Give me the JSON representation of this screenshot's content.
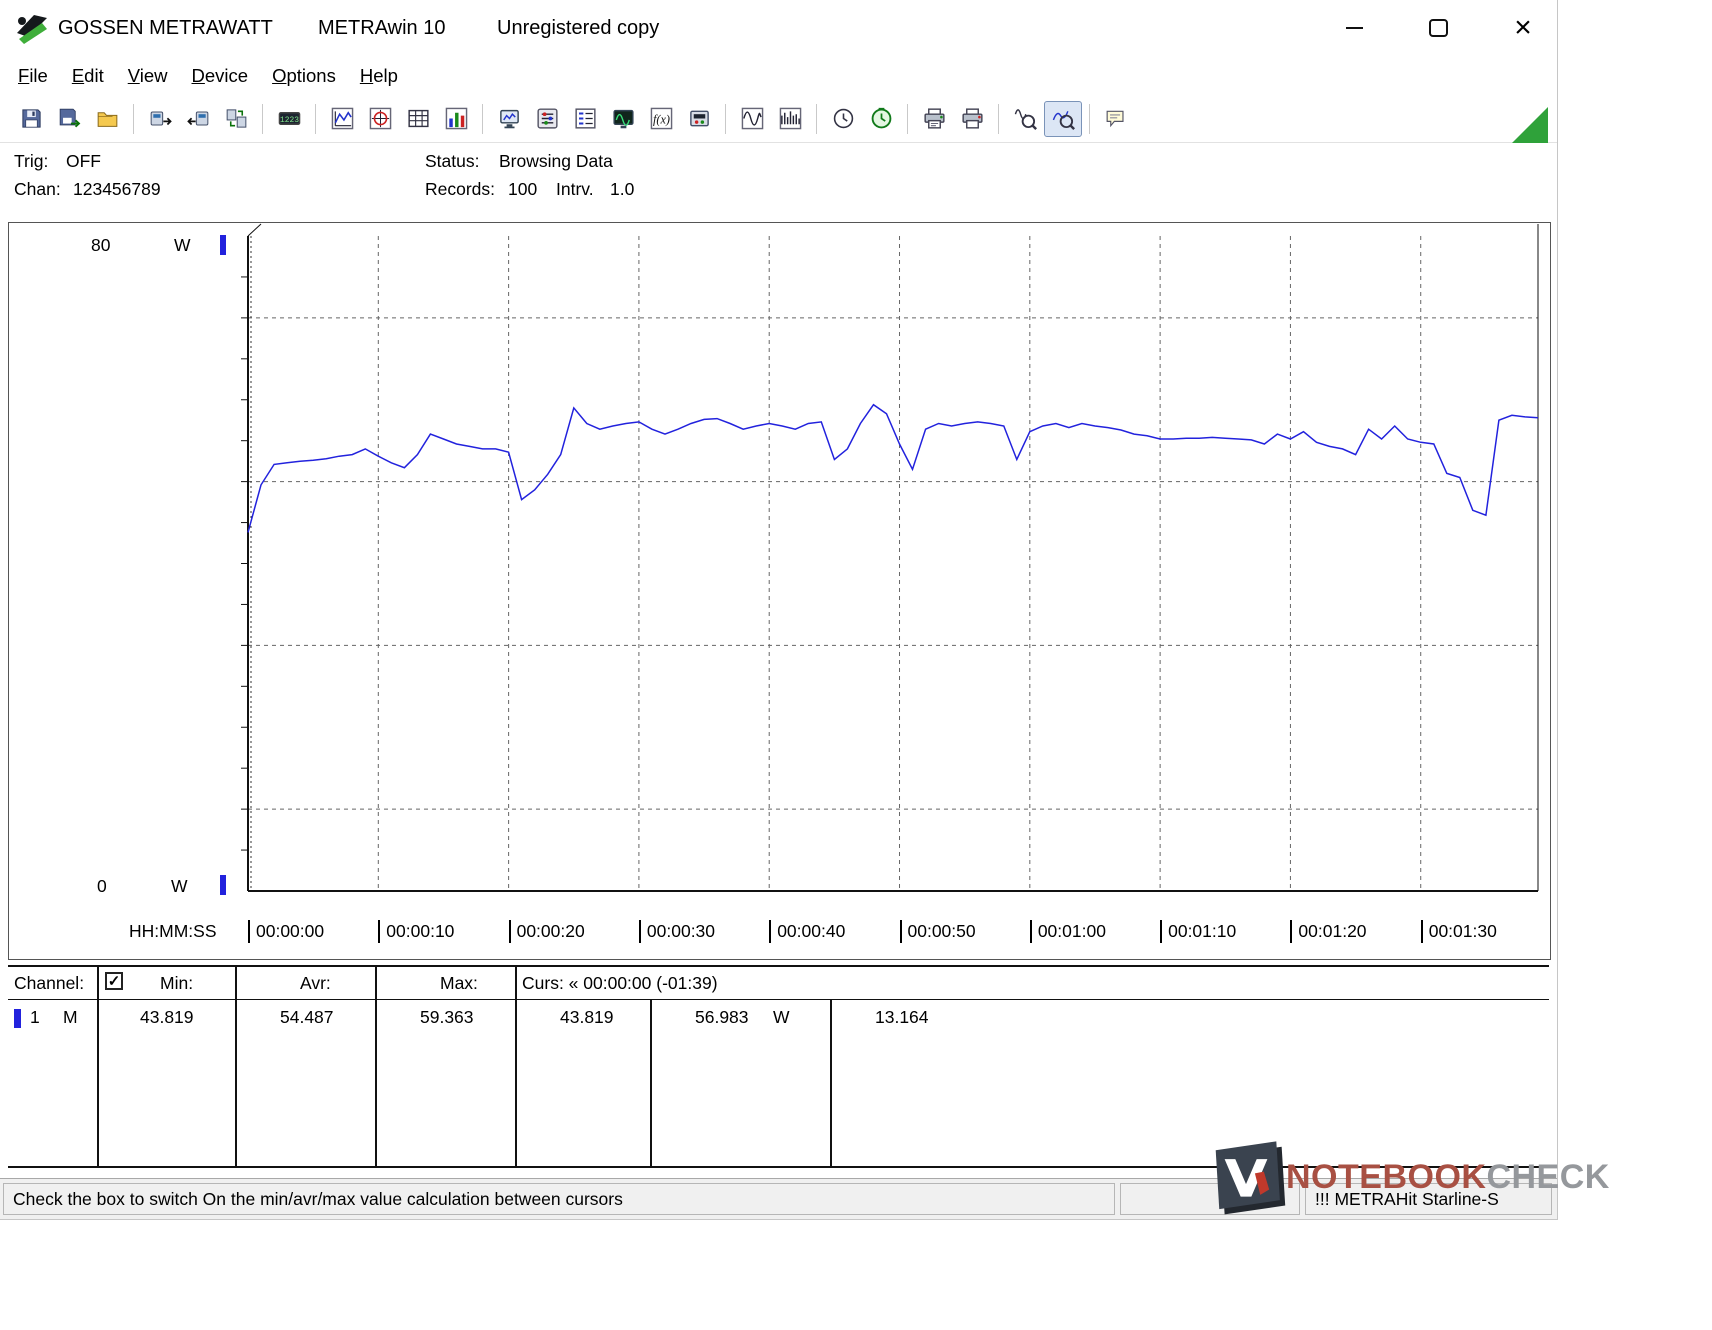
{
  "window": {
    "brand": "GOSSEN METRAWATT",
    "app_name": "METRAwin 10",
    "license": "Unregistered copy",
    "controls": [
      "minimize",
      "maximize",
      "close"
    ]
  },
  "icons": {
    "close": "×",
    "check": "✓"
  },
  "menu": {
    "items": [
      "File",
      "Edit",
      "View",
      "Device",
      "Options",
      "Help"
    ]
  },
  "toolbar": {
    "buttons": [
      "save",
      "save-as",
      "open",
      "upload-device",
      "download-device",
      "transfer-device",
      "numeric-display",
      "yt-chart",
      "xy-chart",
      "table-view",
      "bar-graph",
      "monitor-config",
      "device-settings",
      "channel-list",
      "monitor-view",
      "formula",
      "device-panel",
      "analog-wave",
      "filter-wave",
      "history-clock",
      "timer",
      "print-preview",
      "print",
      "zoom-signal",
      "zoom-mode",
      "annotation"
    ],
    "pressed": "zoom-mode"
  },
  "info": {
    "trig_label": "Trig:",
    "trig_value": "OFF",
    "chan_label": "Chan:",
    "chan_value": "123456789",
    "status_label": "Status:",
    "status_value": "Browsing Data",
    "records_label": "Records:",
    "records_value": "100",
    "intrv_label": "Intrv.",
    "intrv_value": "1.0"
  },
  "chart_data": {
    "type": "line",
    "title": "",
    "xlabel": "HH:MM:SS",
    "ylabel": "W",
    "ylim": [
      0,
      80
    ],
    "x_max_s": 99,
    "x_tick_step_s": 10,
    "x_ticks": [
      "00:00:00",
      "00:00:10",
      "00:00:20",
      "00:00:30",
      "00:00:40",
      "00:00:50",
      "00:01:00",
      "00:01:10",
      "00:01:20",
      "00:01:30"
    ],
    "y_axis_labels": {
      "top_value": "80",
      "top_unit": "W",
      "bottom_value": "0",
      "bottom_unit": "W"
    },
    "grid": {
      "h_lines_w": [
        10,
        30,
        50,
        70
      ],
      "v_lines_s": [
        10,
        20,
        30,
        40,
        50,
        60,
        70,
        80,
        90
      ]
    },
    "cursor": {
      "position_s": 0,
      "label": "00:00:00",
      "color": "#2222dd"
    },
    "series": [
      {
        "name": "channel-1-power-w",
        "color": "#2222dd",
        "x_step_s": 1,
        "values": [
          43.8,
          49.6,
          52.1,
          52.3,
          52.5,
          52.6,
          52.8,
          53.1,
          53.3,
          54.0,
          53.1,
          52.3,
          51.7,
          53.3,
          55.8,
          55.2,
          54.6,
          54.3,
          54.0,
          54.0,
          53.6,
          47.8,
          49.0,
          50.9,
          53.3,
          59.0,
          57.1,
          56.4,
          56.8,
          57.1,
          57.3,
          56.4,
          55.8,
          56.4,
          57.1,
          57.6,
          57.7,
          57.1,
          56.4,
          56.8,
          57.1,
          56.8,
          56.4,
          57.1,
          57.3,
          52.7,
          54.0,
          57.1,
          59.4,
          58.3,
          54.6,
          51.5,
          56.4,
          57.1,
          56.8,
          57.1,
          57.3,
          57.1,
          56.8,
          52.7,
          56.1,
          56.8,
          57.1,
          56.6,
          57.1,
          56.8,
          56.6,
          56.3,
          55.8,
          55.6,
          55.2,
          55.2,
          55.3,
          55.3,
          55.4,
          55.3,
          55.2,
          55.1,
          54.6,
          55.8,
          55.2,
          56.1,
          54.8,
          54.3,
          54.0,
          53.3,
          56.4,
          55.2,
          56.8,
          55.2,
          54.8,
          54.6,
          51.0,
          50.5,
          46.5,
          45.9,
          57.5,
          58.1,
          57.9,
          57.8
        ]
      }
    ]
  },
  "table": {
    "header": {
      "channel": "Channel:",
      "min": "Min:",
      "avr": "Avr:",
      "max": "Max:",
      "curs": "Curs: « 00:00:00 (-01:39)"
    },
    "checkbox_checked": true,
    "row": {
      "channel": "1",
      "unit": "M",
      "min": "43.819",
      "avr": "54.487",
      "max": "59.363",
      "curs_val1": "43.819",
      "curs_val2": "56.983",
      "curs_unit": "W",
      "curs_delta": "13.164",
      "marker_color": "#2222dd"
    }
  },
  "statusbar": {
    "message": "Check the box to switch On the min/avr/max value calculation between cursors",
    "device": "!!! METRAHit Starline-S"
  },
  "watermark": {
    "part1": "NOTEBOOK",
    "part2": "CHECK"
  }
}
